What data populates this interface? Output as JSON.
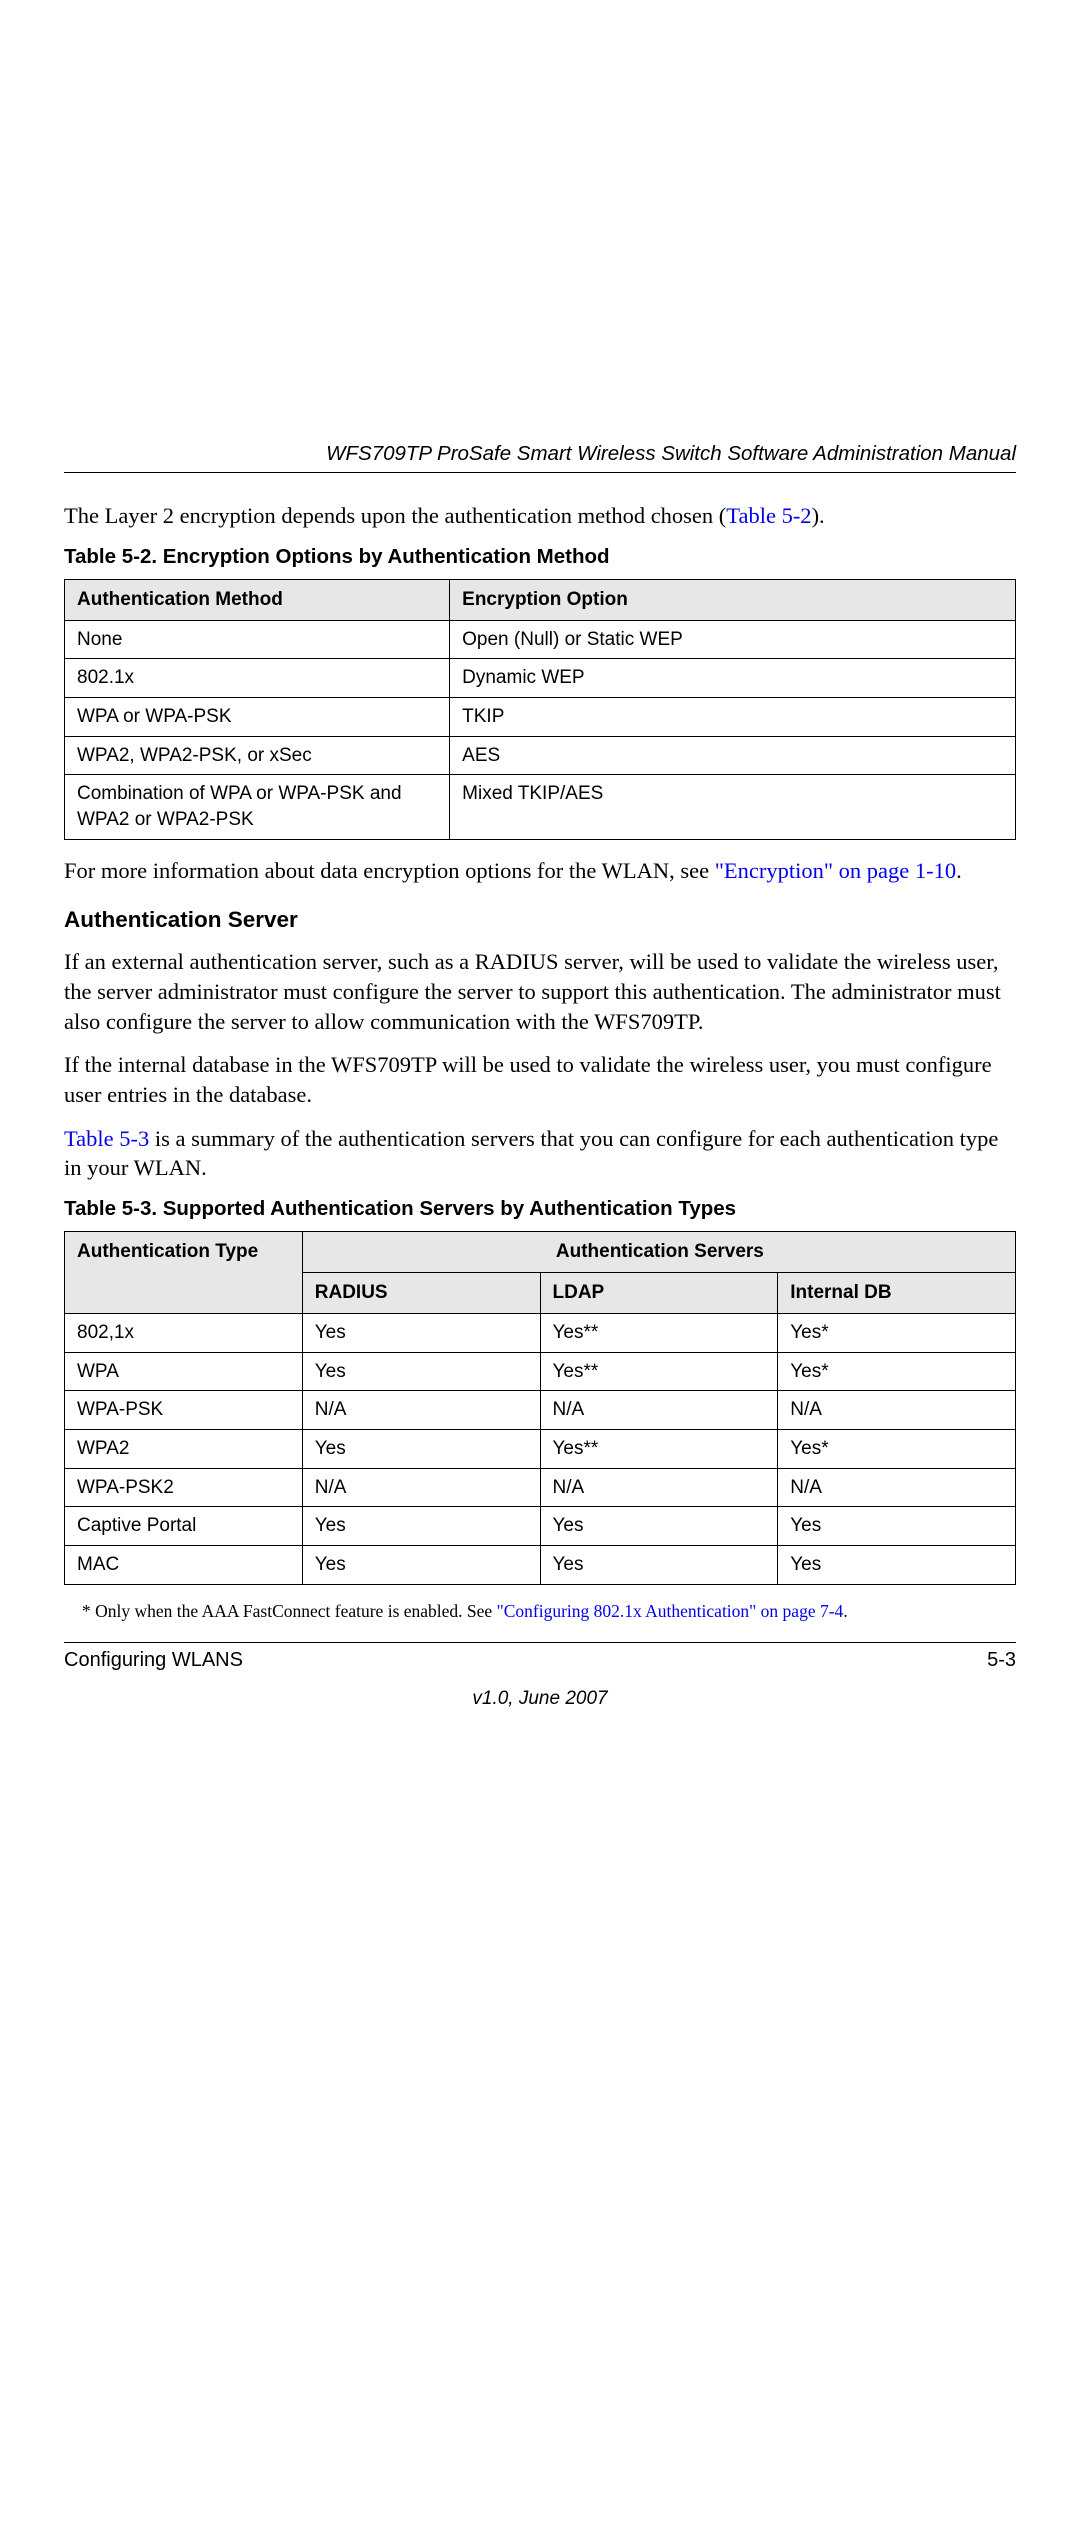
{
  "header": {
    "title": "WFS709TP ProSafe Smart Wireless Switch Software Administration Manual"
  },
  "para1": {
    "pre": "The Layer 2 encryption depends upon the authentication method chosen (",
    "link": "Table 5-2",
    "post": ")."
  },
  "table52_caption": "Table 5-2.  Encryption Options by Authentication Method",
  "table52": {
    "headers": [
      "Authentication Method",
      "Encryption Option"
    ],
    "rows": [
      [
        "None",
        "Open (Null) or Static WEP"
      ],
      [
        "802.1x",
        "Dynamic WEP"
      ],
      [
        "WPA or WPA-PSK",
        "TKIP"
      ],
      [
        "WPA2, WPA2-PSK, or xSec",
        "AES"
      ],
      [
        "Combination of WPA or WPA-PSK and WPA2 or WPA2-PSK",
        "Mixed TKIP/AES"
      ]
    ]
  },
  "para2": {
    "pre": "For more information about data encryption options for the WLAN, see ",
    "link": "\"Encryption\" on page 1-10",
    "post": "."
  },
  "h_auth_server": "Authentication Server",
  "para3": "If an external authentication server, such as a RADIUS server, will be used to validate the wireless user, the server administrator must configure the server to support this authentication. The administrator must also configure the server to allow communication with the WFS709TP.",
  "para4": "If the internal database in the WFS709TP will be used to validate the wireless user, you must configure user entries in the database.",
  "para5": {
    "link": "Table 5-3",
    "post": " is a summary of the authentication servers that you can configure for each authentication type in your WLAN."
  },
  "table53_caption": "Table 5-3.  Supported Authentication Servers by Authentication Types",
  "table53": {
    "top_header_type": "Authentication Type",
    "top_header_servers": "Authentication Servers",
    "sub_headers": [
      "RADIUS",
      "LDAP",
      "Internal DB"
    ],
    "rows": [
      [
        "802,1x",
        "Yes",
        "Yes**",
        "Yes*"
      ],
      [
        "WPA",
        "Yes",
        "Yes**",
        "Yes*"
      ],
      [
        "WPA-PSK",
        "N/A",
        "N/A",
        "N/A"
      ],
      [
        "WPA2",
        "Yes",
        "Yes**",
        "Yes*"
      ],
      [
        "WPA-PSK2",
        "N/A",
        "N/A",
        "N/A"
      ],
      [
        "Captive Portal",
        "Yes",
        "Yes",
        "Yes"
      ],
      [
        "MAC",
        "Yes",
        "Yes",
        "Yes"
      ]
    ]
  },
  "footnote": {
    "pre": "* Only when the AAA FastConnect feature is enabled. See ",
    "link": "\"Configuring 802.1x Authentication\" on page 7-4",
    "post": "."
  },
  "footer": {
    "section": "Configuring WLANS",
    "page": "5-3"
  },
  "version": "v1.0, June 2007"
}
